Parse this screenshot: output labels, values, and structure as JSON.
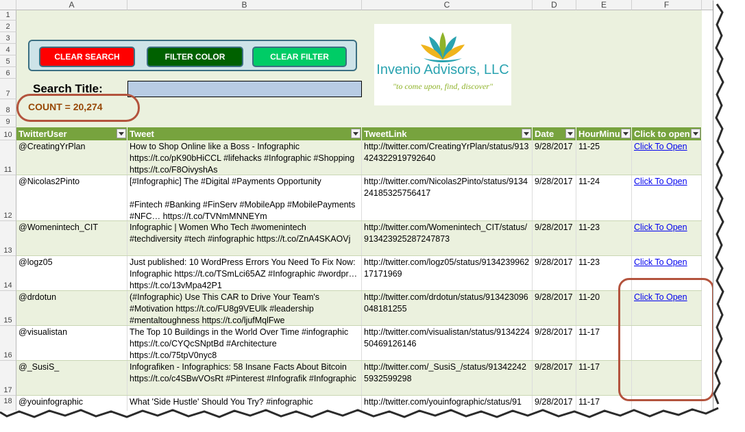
{
  "columns": [
    "A",
    "B",
    "C",
    "D",
    "E",
    "F"
  ],
  "row_numbers": [
    "1",
    "2",
    "3",
    "4",
    "5",
    "6",
    "7",
    "8",
    "9",
    "10",
    "11",
    "12",
    "13",
    "14",
    "15",
    "16",
    "17",
    "18"
  ],
  "buttons": {
    "clear_search": "CLEAR SEARCH",
    "filter_color": "FILTER COLOR",
    "clear_filter": "CLEAR FILTER"
  },
  "search": {
    "label": "Search Title:",
    "value": ""
  },
  "count_text": "COUNT = 20,274",
  "logo": {
    "name": "Invenio Advisors, LLC",
    "tagline": "\"to come upon, find, discover\""
  },
  "headers": [
    "TwitterUser",
    "Tweet",
    "TweetLink",
    "Date",
    "HourMinu",
    "Click to open"
  ],
  "rows": [
    {
      "user": "@CreatingYrPlan",
      "tweet": "How to Shop Online like a Boss - Infographic https://t.co/pK90bHiCCL #lifehacks #Infographic #Shopping https://t.co/F8OivyshAs",
      "link": "http://twitter.com/CreatingYrPlan/status/913424322919792640",
      "date": "9/28/2017",
      "hm": "11-25",
      "open": "Click To Open"
    },
    {
      "user": "@Nicolas2Pinto",
      "tweet": "[#Infographic] The #Digital #Payments Opportunity\n\n#Fintech #Banking #FinServ #MobileApp #MobilePayments #NFC… https://t.co/TVNmMNNEYm",
      "link": "http://twitter.com/Nicolas2Pinto/status/913424185325756417",
      "date": "9/28/2017",
      "hm": "11-24",
      "open": "Click To Open"
    },
    {
      "user": "@Womenintech_CIT",
      "tweet": "Infographic | Women Who Tech #womenintech #techdiversity #tech #infographic https://t.co/ZnA4SKAOVj",
      "link": "http://twitter.com/Womenintech_CIT/status/913423925287247873",
      "date": "9/28/2017",
      "hm": "11-23",
      "open": "Click To Open"
    },
    {
      "user": "@logz05",
      "tweet": "Just published: 10 WordPress Errors You Need To Fix Now: Infographic https://t.co/TSmLci65AZ #Infographic #wordpr… https://t.co/13vMpa42P1",
      "link": "http://twitter.com/logz05/status/913423996217171969",
      "date": "9/28/2017",
      "hm": "11-23",
      "open": "Click To Open"
    },
    {
      "user": "@drdotun",
      "tweet": "(#Infographic) Use This CAR to Drive Your Team's #Motivation https://t.co/FU8g9VEUlk #leadership #mentaltoughness https://t.co/ljufMqlFwe",
      "link": "http://twitter.com/drdotun/status/913423096048181255",
      "date": "9/28/2017",
      "hm": "11-20",
      "open": "Click To Open"
    },
    {
      "user": "@visualistan",
      "tweet": "The Top 10 Buildings in the World Over Time #infographic https://t.co/CYQcSNptBd #Architecture https://t.co/75tpV0nyc8",
      "link": "http://twitter.com/visualistan/status/913422450469126146",
      "date": "9/28/2017",
      "hm": "11-17",
      "open": ""
    },
    {
      "user": "@_SusiS_",
      "tweet": "Infografiken - Infographics: 58 Insane Facts About Bitcoin https://t.co/c4SBwVOsRt #Pinterest #Infografik #Infographic",
      "link": "http://twitter.com/_SusiS_/status/913422425932599298",
      "date": "9/28/2017",
      "hm": "11-17",
      "open": ""
    },
    {
      "user": "@youinfographic",
      "tweet": "What 'Side Hustle' Should You Try? #infographic",
      "link": "http://twitter.com/youinfographic/status/91",
      "date": "9/28/2017",
      "hm": "11-17",
      "open": ""
    }
  ],
  "colors": {
    "header_green": "#77a33e",
    "band_green": "#ebf1de",
    "clear_search": "#ff0000",
    "filter_color": "#006100",
    "clear_filter": "#00cc66",
    "count_text": "#974706",
    "highlight": "#b3533d"
  }
}
